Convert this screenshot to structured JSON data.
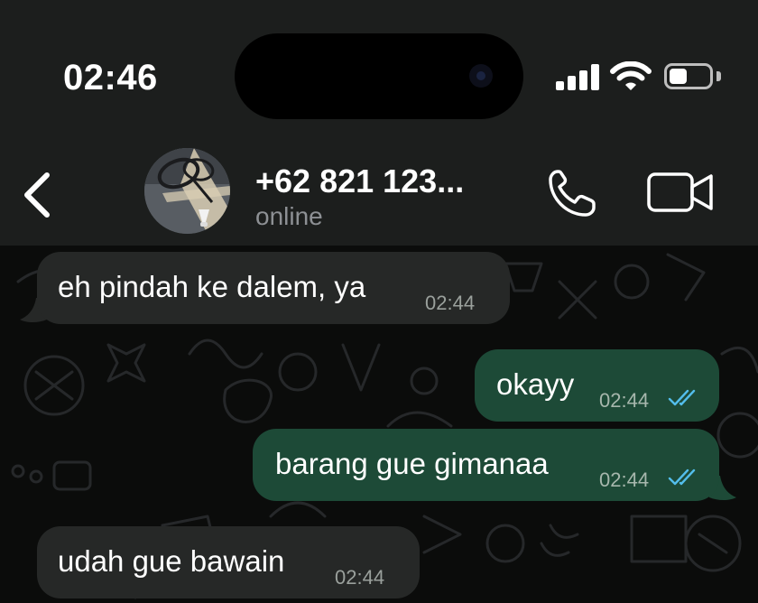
{
  "status_bar": {
    "time": "02:46",
    "signal_bars": 4,
    "battery_level_fraction": 0.45
  },
  "header": {
    "contact_name": "+62 821 123...",
    "contact_status": "online",
    "icons": [
      "back-chevron-icon",
      "phone-icon",
      "video-camera-icon"
    ]
  },
  "messages": [
    {
      "direction": "incoming",
      "text": "eh pindah ke dalem, ya",
      "time": "02:44"
    },
    {
      "direction": "outgoing",
      "text": "okayy",
      "time": "02:44",
      "status": "read"
    },
    {
      "direction": "outgoing",
      "text": "barang gue gimanaa",
      "time": "02:44",
      "status": "read"
    },
    {
      "direction": "incoming",
      "text": "udah gue bawain",
      "time": "02:44"
    }
  ],
  "colors": {
    "incoming_bubble": "#262827",
    "outgoing_bubble": "#1d4a37",
    "read_ticks": "#53bdeb",
    "header_background": "#1c1e1d",
    "chat_background": "#0b0c0b"
  }
}
